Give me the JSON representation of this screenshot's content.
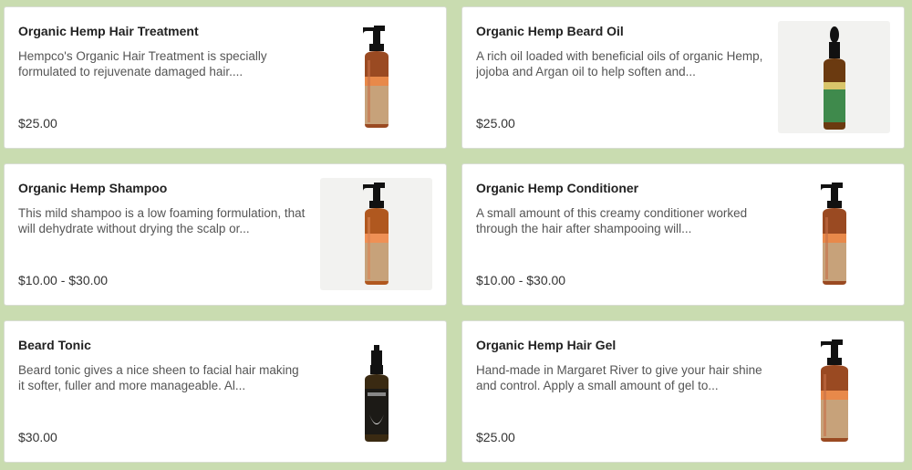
{
  "products": [
    {
      "title": "Organic Hemp Hair Treatment",
      "description": "Hempco's Organic Hair Treatment is specially formulated to rejuvenate damaged hair....",
      "price": "$25.00",
      "image_icon": "pump-bottle-icon",
      "bottle_color": "#9a4a22"
    },
    {
      "title": "Organic Hemp Beard Oil",
      "description": "A rich oil loaded with beneficial oils of organic Hemp, jojoba and Argan oil to help soften and...",
      "price": "$25.00",
      "image_icon": "dropper-bottle-icon",
      "bottle_color": "#6b3a10"
    },
    {
      "title": "Organic Hemp Shampoo",
      "description": "This mild shampoo is a low foaming formulation, that will dehydrate without drying the scalp or...",
      "price": "$10.00 - $30.00",
      "image_icon": "pump-bottle-icon",
      "bottle_color": "#b0581f"
    },
    {
      "title": "Organic Hemp Conditioner",
      "description": "A small amount of this creamy conditioner worked through the hair after shampooing will...",
      "price": "$10.00 - $30.00",
      "image_icon": "pump-bottle-icon",
      "bottle_color": "#9a4a22"
    },
    {
      "title": "Beard Tonic",
      "description": "Beard tonic gives a nice sheen to facial hair making it softer, fuller and more manageable. Al...",
      "price": "$30.00",
      "image_icon": "spray-bottle-icon",
      "bottle_color": "#3a2a12"
    },
    {
      "title": "Organic Hemp Hair Gel",
      "description": "Hand-made in Margaret River to give your hair shine and control. Apply a small amount of gel to...",
      "price": "$25.00",
      "image_icon": "pump-bottle-icon",
      "bottle_color": "#9a4a22"
    }
  ]
}
